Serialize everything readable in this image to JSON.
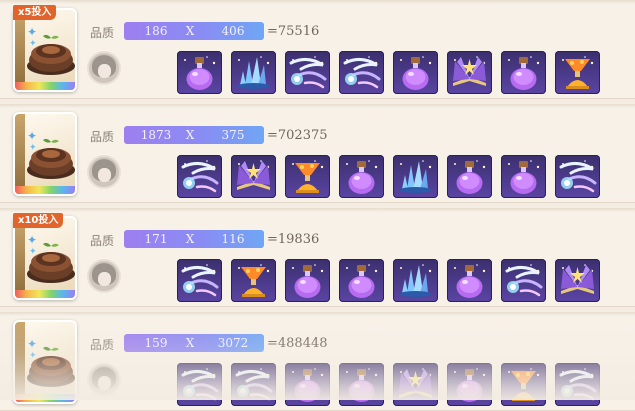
{
  "rows": [
    {
      "badge": "x5投入",
      "label": "品质",
      "a": "186",
      "op": "X",
      "b": "406",
      "result": "=75516",
      "items": [
        "potion-purple",
        "crystal",
        "wind",
        "wind",
        "potion-purple",
        "book",
        "potion-purple",
        "potion-orange"
      ]
    },
    {
      "badge": "",
      "label": "品质",
      "a": "1873",
      "op": "X",
      "b": "375",
      "result": "=702375",
      "items": [
        "wind",
        "book",
        "potion-orange",
        "potion-purple",
        "crystal",
        "potion-purple",
        "potion-purple",
        "wind"
      ]
    },
    {
      "badge": "x10投入",
      "label": "品质",
      "a": "171",
      "op": "X",
      "b": "116",
      "result": "=19836",
      "items": [
        "wind",
        "potion-orange",
        "potion-purple",
        "potion-purple",
        "crystal",
        "potion-purple",
        "wind",
        "book"
      ]
    },
    {
      "badge": "",
      "label": "品质",
      "a": "159",
      "op": "X",
      "b": "3072",
      "result": "=488448",
      "items": [
        "wind",
        "wind",
        "potion-purple",
        "potion-purple",
        "book",
        "potion-purple",
        "potion-orange",
        "wind"
      ]
    }
  ],
  "colors": {
    "formula_left": "#9d7ff0",
    "formula_right": "#6fa6f5",
    "badge": "#e0642c"
  },
  "icons": {
    "card": "cake-icon",
    "avatar": "character-avatar-icon"
  }
}
